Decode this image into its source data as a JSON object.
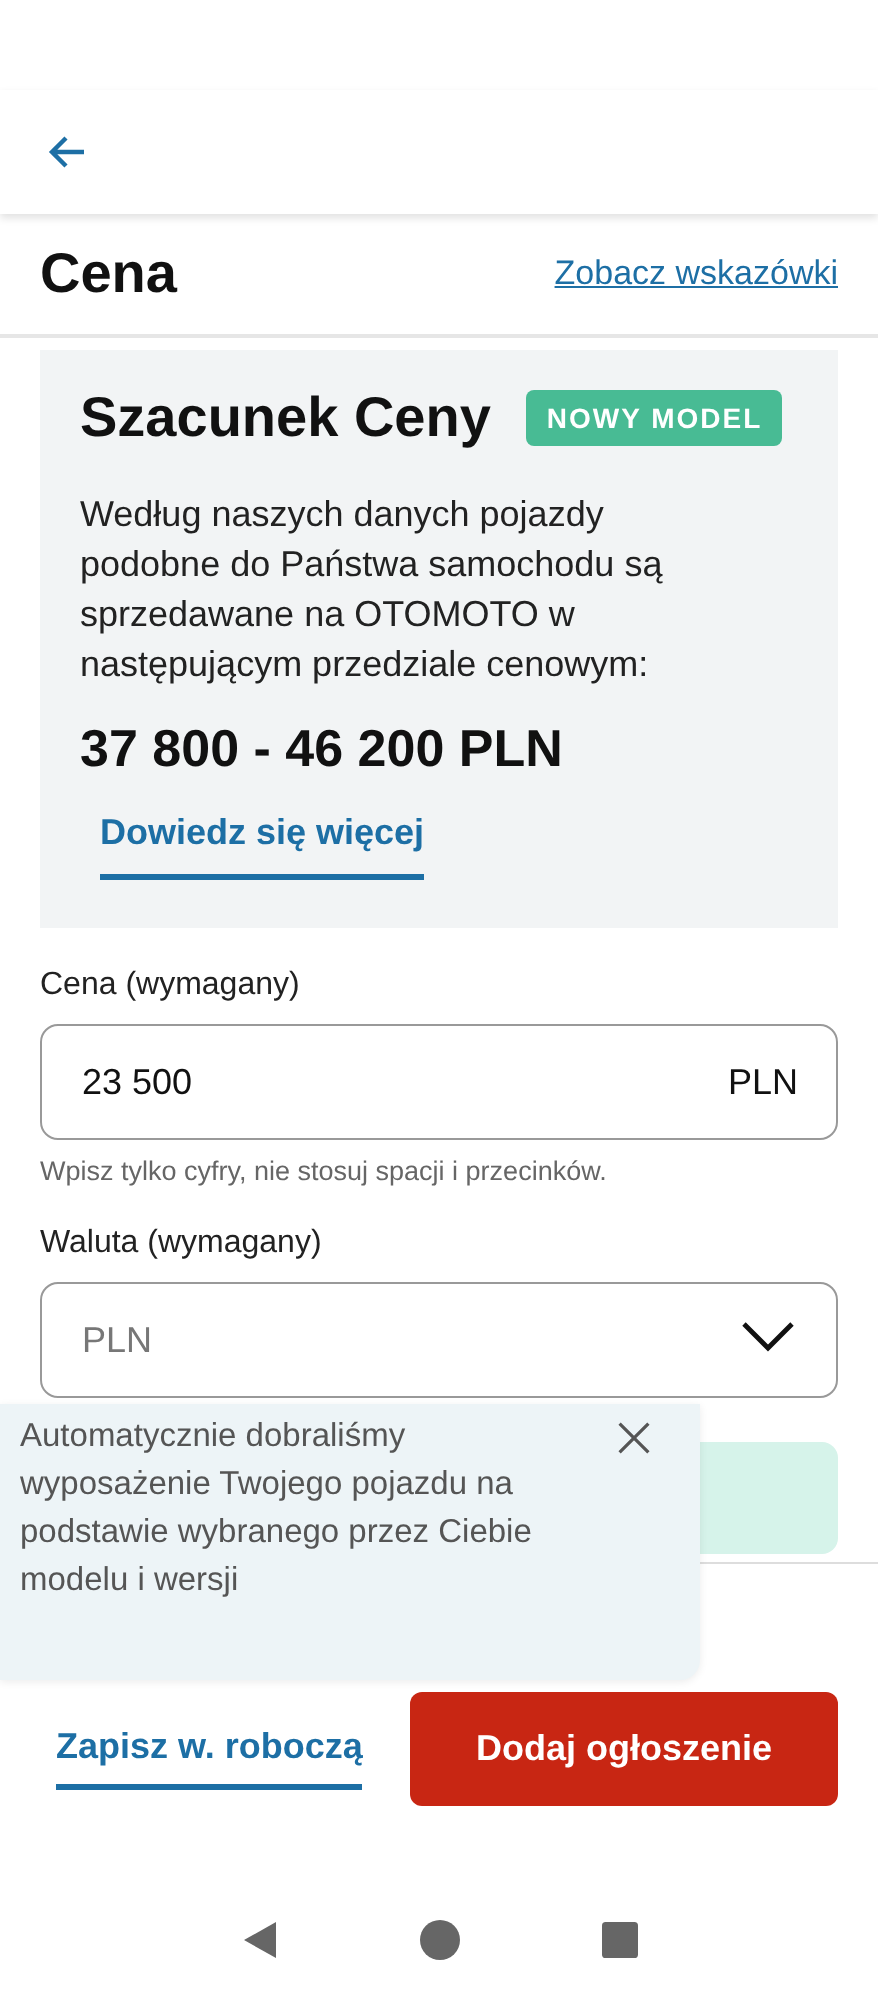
{
  "header": {
    "title": "Cena",
    "link": "Zobacz wskazówki"
  },
  "estimate": {
    "title": "Szacunek Ceny",
    "badge": "NOWY MODEL",
    "text": "Według naszych danych pojazdy podobne do Państwa samochodu są sprzedawane na OTOMOTO w następującym przedziale cenowym:",
    "range": "37 800 - 46 200 PLN",
    "more": "Dowiedz się więcej"
  },
  "price": {
    "label": "Cena (wymagany)",
    "value": "23 500",
    "unit": "PLN",
    "hint": "Wpisz tylko cyfry, nie stosuj spacji i przecinków."
  },
  "currency": {
    "label": "Waluta (wymagany)",
    "value": "PLN"
  },
  "toast": {
    "text": "Automatycznie dobraliśmy wyposażenie Twojego pojazdu na podstawie wybranego przez Ciebie modelu i wersji"
  },
  "buttons": {
    "draft": "Zapisz w. roboczą",
    "submit": "Dodaj ogłoszenie"
  }
}
